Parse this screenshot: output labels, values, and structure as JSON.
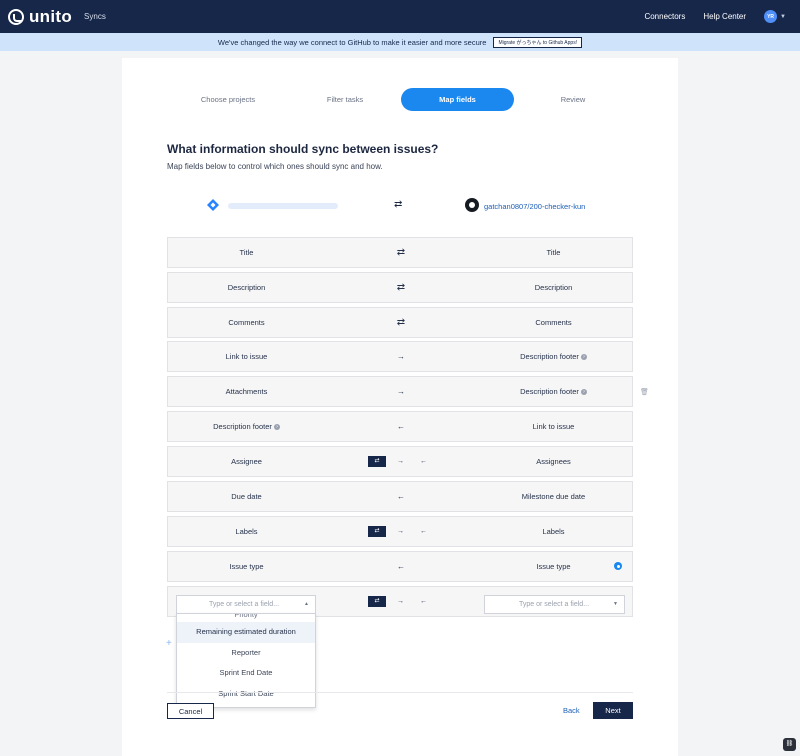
{
  "topbar": {
    "brand": "unito",
    "section": "Syncs",
    "nav": [
      "Connectors",
      "Help Center"
    ],
    "avatar_initials": "YR"
  },
  "banner": {
    "message": "We've changed the way we connect to GitHub to make it easier and more secure",
    "button": "Migrate がっちゃん to Github Apps!"
  },
  "steps": [
    {
      "label": "Choose projects",
      "active": false
    },
    {
      "label": "Filter tasks",
      "active": false
    },
    {
      "label": "Map fields",
      "active": true
    },
    {
      "label": "Review",
      "active": false
    }
  ],
  "main": {
    "title": "What information should sync between issues?",
    "subtitle": "Map fields below to control which ones should sync and how.",
    "target_repo": "gatchan0807/200-checker-kun"
  },
  "mappings": [
    {
      "left": "Title",
      "dir": "⇄",
      "right": "Title"
    },
    {
      "left": "Description",
      "dir": "⇄",
      "right": "Description"
    },
    {
      "left": "Comments",
      "dir": "⇄",
      "right": "Comments"
    },
    {
      "left": "Link to issue",
      "dir": "→",
      "right": "Description footer"
    },
    {
      "left": "Attachments",
      "dir": "→",
      "right": "Description footer"
    },
    {
      "left": "Description footer",
      "dir": "←",
      "right": "Link to issue"
    },
    {
      "left": "Assignee",
      "dir": "options",
      "right": "Assignees"
    },
    {
      "left": "Due date",
      "dir": "←",
      "right": "Milestone due date"
    },
    {
      "left": "Labels",
      "dir": "options",
      "right": "Labels"
    },
    {
      "left": "Issue type",
      "dir": "←",
      "right": "Issue type"
    }
  ],
  "new_mapping": {
    "left_placeholder": "Type or select a field...",
    "right_placeholder": "Type or select a field..."
  },
  "dropdown": {
    "cut_item": "Priority",
    "items": [
      "Remaining estimated duration",
      "Reporter",
      "Sprint End Date",
      "Sprint Start Date"
    ],
    "highlighted": "Remaining estimated duration"
  },
  "symbols": {
    "swap": "⇄",
    "right": "→",
    "left": "←",
    "plus": "+"
  },
  "footer": {
    "cancel": "Cancel",
    "back": "Back",
    "next": "Next"
  },
  "colors": {
    "navy": "#17274a",
    "accent": "#1b88f0",
    "banner": "#cfe4fb"
  }
}
